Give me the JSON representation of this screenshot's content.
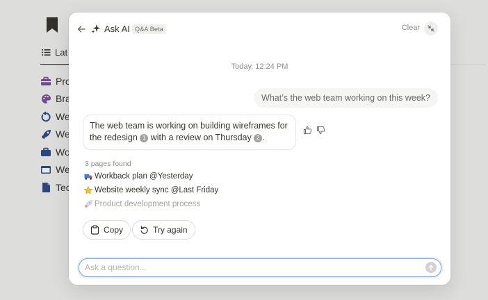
{
  "background": {
    "tab_label": "Lat",
    "items": [
      {
        "label": "Pro",
        "icon": "toolbox-icon",
        "color": "#7a4f9c"
      },
      {
        "label": "Bra",
        "icon": "palette-icon",
        "color": "#7a4f9c"
      },
      {
        "label": "We",
        "icon": "refresh-icon",
        "color": "#2f4f8a"
      },
      {
        "label": "We",
        "icon": "rocket-icon",
        "color": "#2f4f8a"
      },
      {
        "label": "Wo",
        "icon": "briefcase-icon",
        "color": "#2f4f8a"
      },
      {
        "label": "We",
        "icon": "browser-icon",
        "color": "#2f4f8a"
      },
      {
        "label": "Tec",
        "icon": "document-icon",
        "color": "#2f4f8a"
      }
    ]
  },
  "header": {
    "title": "Ask AI",
    "badge": "Q&A Beta",
    "clear_label": "Clear"
  },
  "conversation": {
    "timestamp": "Today, 12:24 PM",
    "user_message": "What’s the web team working on this week?",
    "ai_response": {
      "line1": "The web team is working on building wireframes for",
      "part_a": "the redesign ",
      "cite1": "1",
      "part_b": " with a review on Thursday ",
      "cite2": "2",
      "part_c": "."
    }
  },
  "sources": {
    "count_label": "3 pages found",
    "items": [
      {
        "emoji": "truck-icon",
        "label": "Workback plan @Yesterday"
      },
      {
        "emoji": "star-icon",
        "label": "Website weekly sync @Last Friday"
      },
      {
        "emoji": "rocket-icon",
        "label": "Product development process"
      }
    ]
  },
  "actions": {
    "copy_label": "Copy",
    "try_again_label": "Try again"
  },
  "input": {
    "placeholder": "Ask a question...",
    "value": ""
  },
  "colors": {
    "accent_focus": "#7aa7e6",
    "muted_text": "#8f8d89"
  }
}
